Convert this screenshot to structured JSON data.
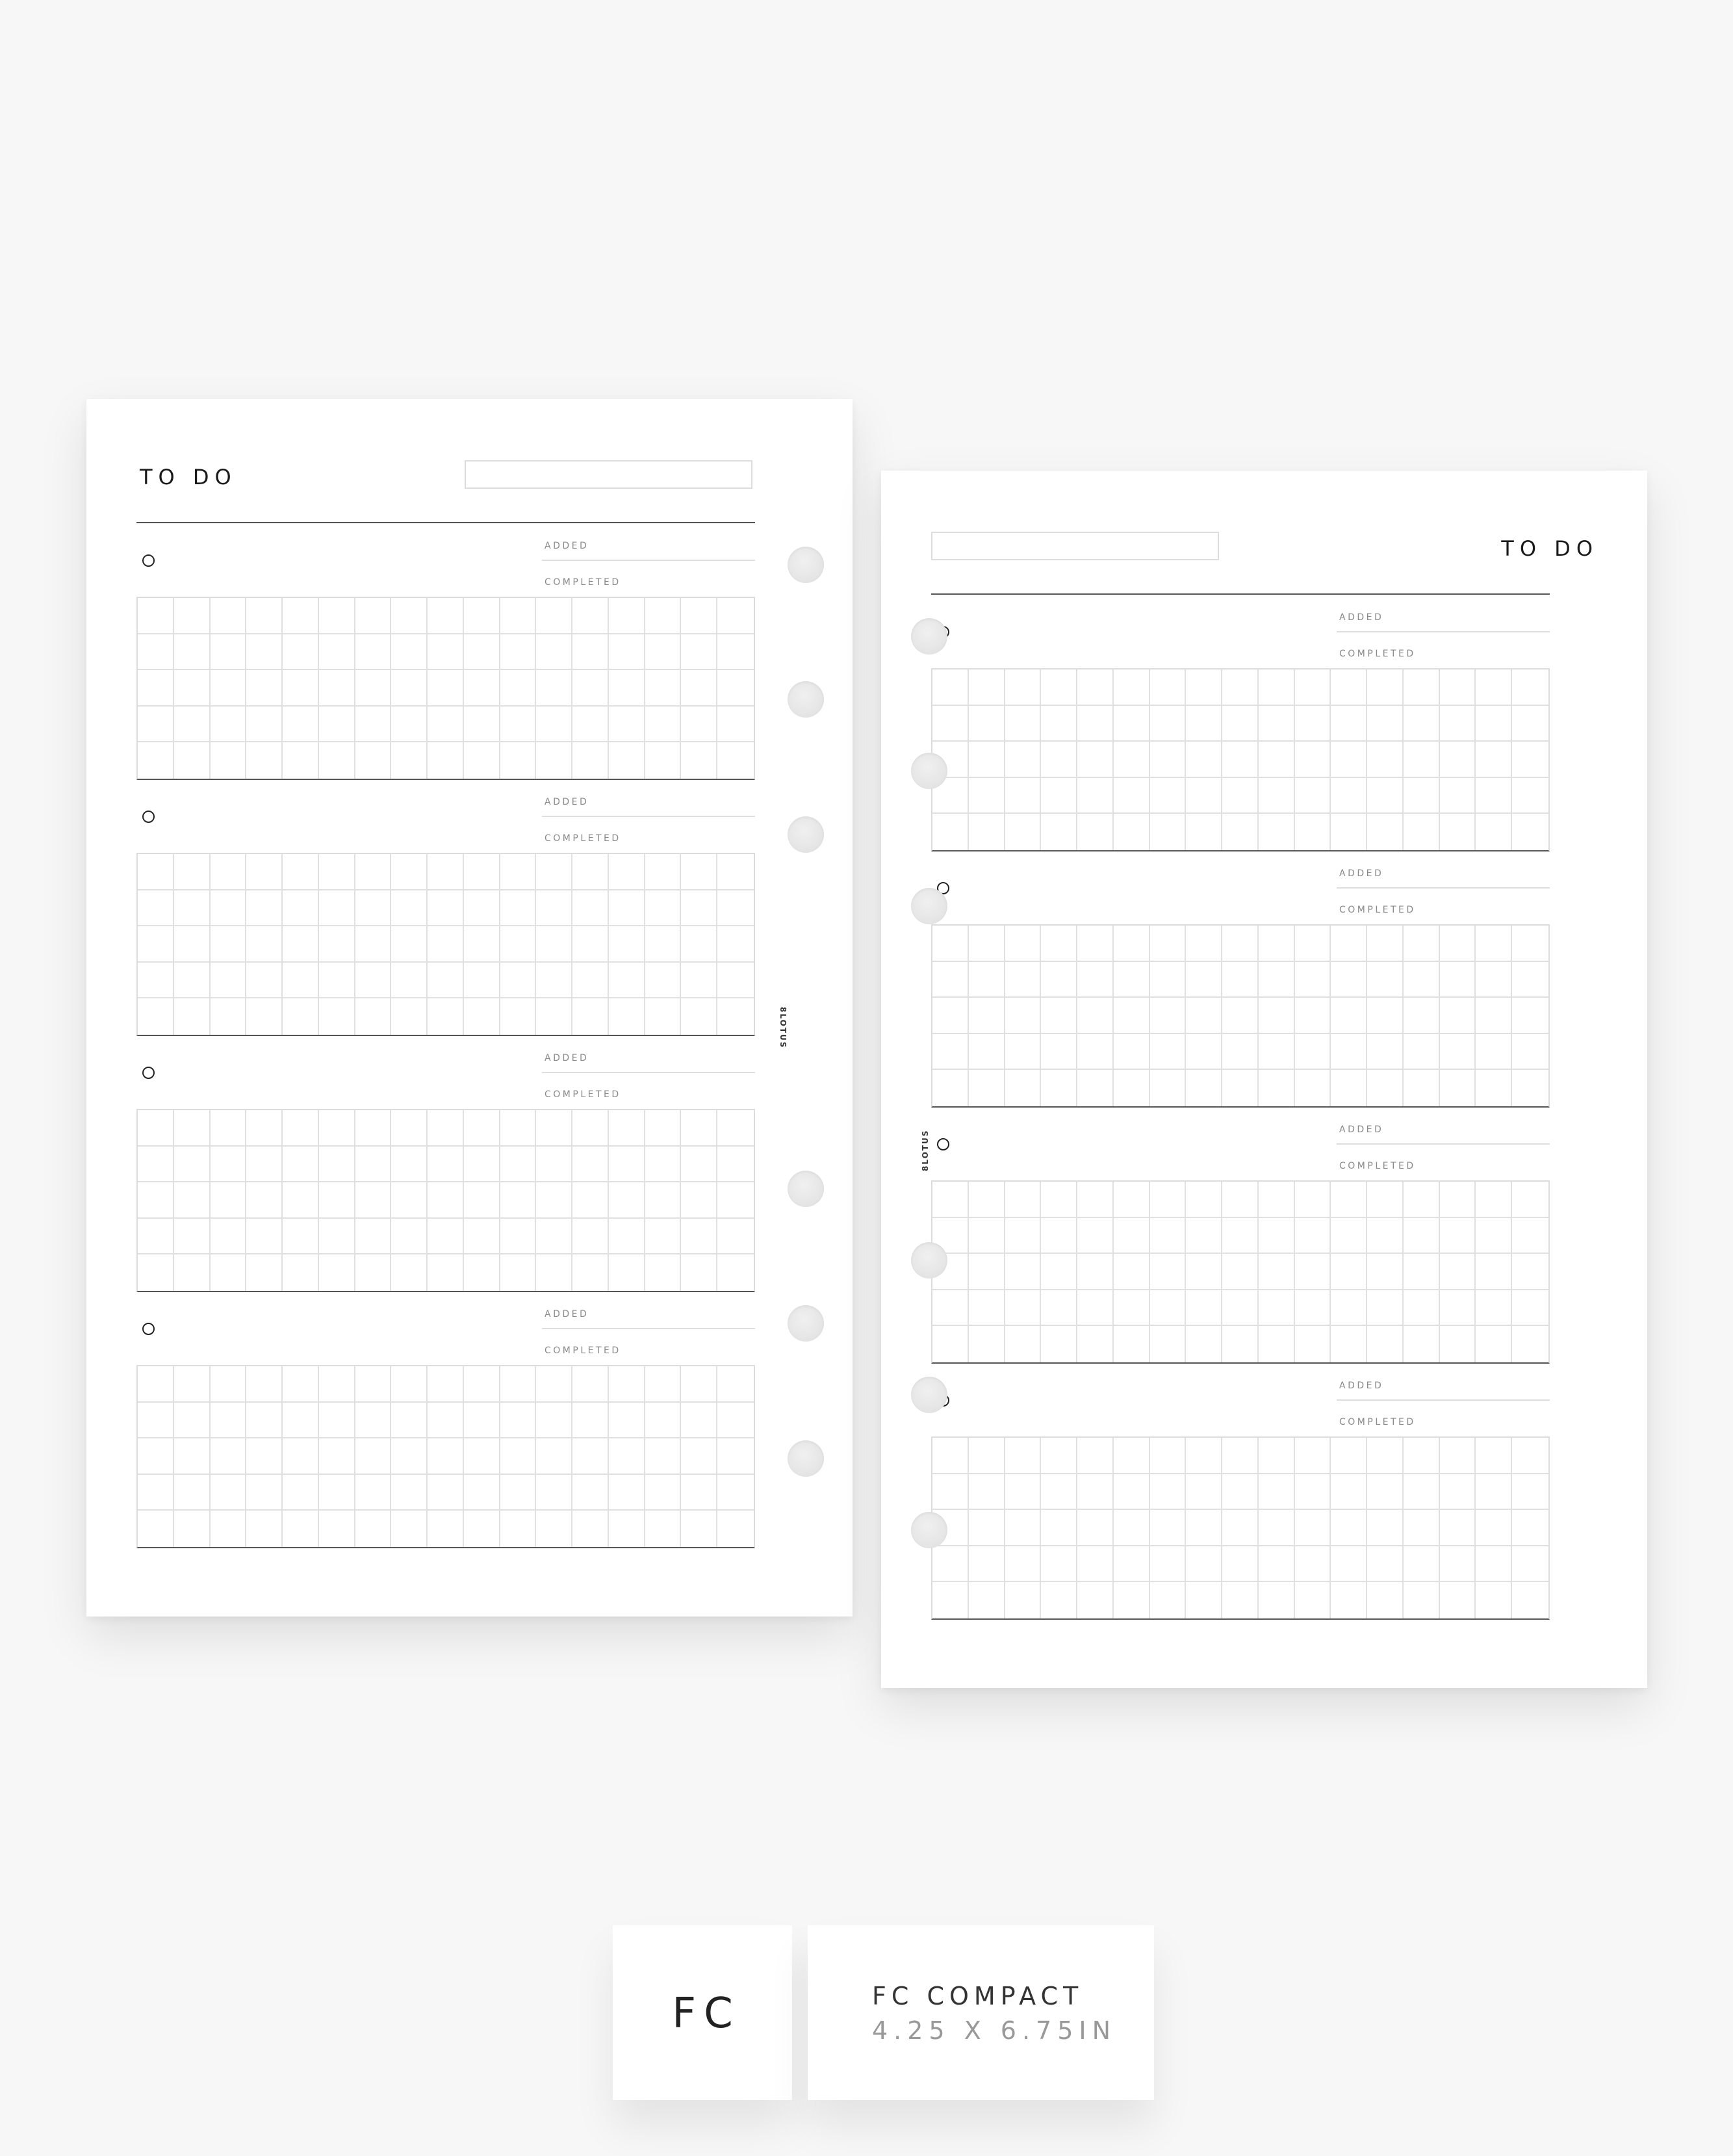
{
  "pages": [
    {
      "side": "left",
      "title": "TO DO",
      "brand": "8LOTUS",
      "sections": [
        {
          "added_label": "ADDED",
          "completed_label": "COMPLETED"
        },
        {
          "added_label": "ADDED",
          "completed_label": "COMPLETED"
        },
        {
          "added_label": "ADDED",
          "completed_label": "COMPLETED"
        },
        {
          "added_label": "ADDED",
          "completed_label": "COMPLETED"
        }
      ],
      "grid": {
        "columns": 17,
        "rows": 5
      },
      "ring_holes": 6
    },
    {
      "side": "right",
      "title": "TO DO",
      "brand": "8LOTUS",
      "sections": [
        {
          "added_label": "ADDED",
          "completed_label": "COMPLETED"
        },
        {
          "added_label": "ADDED",
          "completed_label": "COMPLETED"
        },
        {
          "added_label": "ADDED",
          "completed_label": "COMPLETED"
        },
        {
          "added_label": "ADDED",
          "completed_label": "COMPLETED"
        }
      ],
      "grid": {
        "columns": 17,
        "rows": 5
      },
      "ring_holes": 6
    }
  ],
  "size_card": {
    "code": "FC",
    "name": "FC COMPACT",
    "dimensions": "4.25 X 6.75IN"
  },
  "colors": {
    "background": "#f7f7f7",
    "paper": "#ffffff",
    "text_dark": "#1a1a1a",
    "label_grey": "#8a8a8a",
    "grid_line": "#e0e0e0",
    "rule_dark": "#555555"
  }
}
